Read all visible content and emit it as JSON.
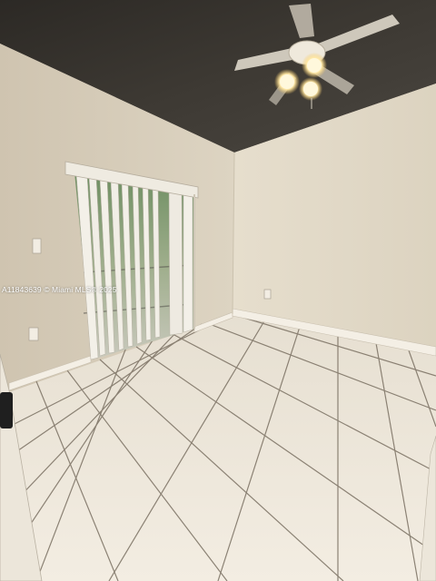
{
  "photo": {
    "watermark": "A11843639 © Miami MLS® 2025",
    "subjects": [
      "ceiling-fan",
      "vertical-blinds",
      "sliding-door",
      "tile-floor",
      "baseboard",
      "wall-outlet",
      "light-switch",
      "door-edge"
    ]
  },
  "colors": {
    "ceiling": "#3a3630",
    "left_wall": "#d8cfbd",
    "right_wall": "#e2dac8",
    "back_wall": "#e9e2d2",
    "floor": "#efe8dc",
    "grout": "#6f665a",
    "baseboard": "#f4efe5",
    "blinds": "#f1eee6"
  }
}
